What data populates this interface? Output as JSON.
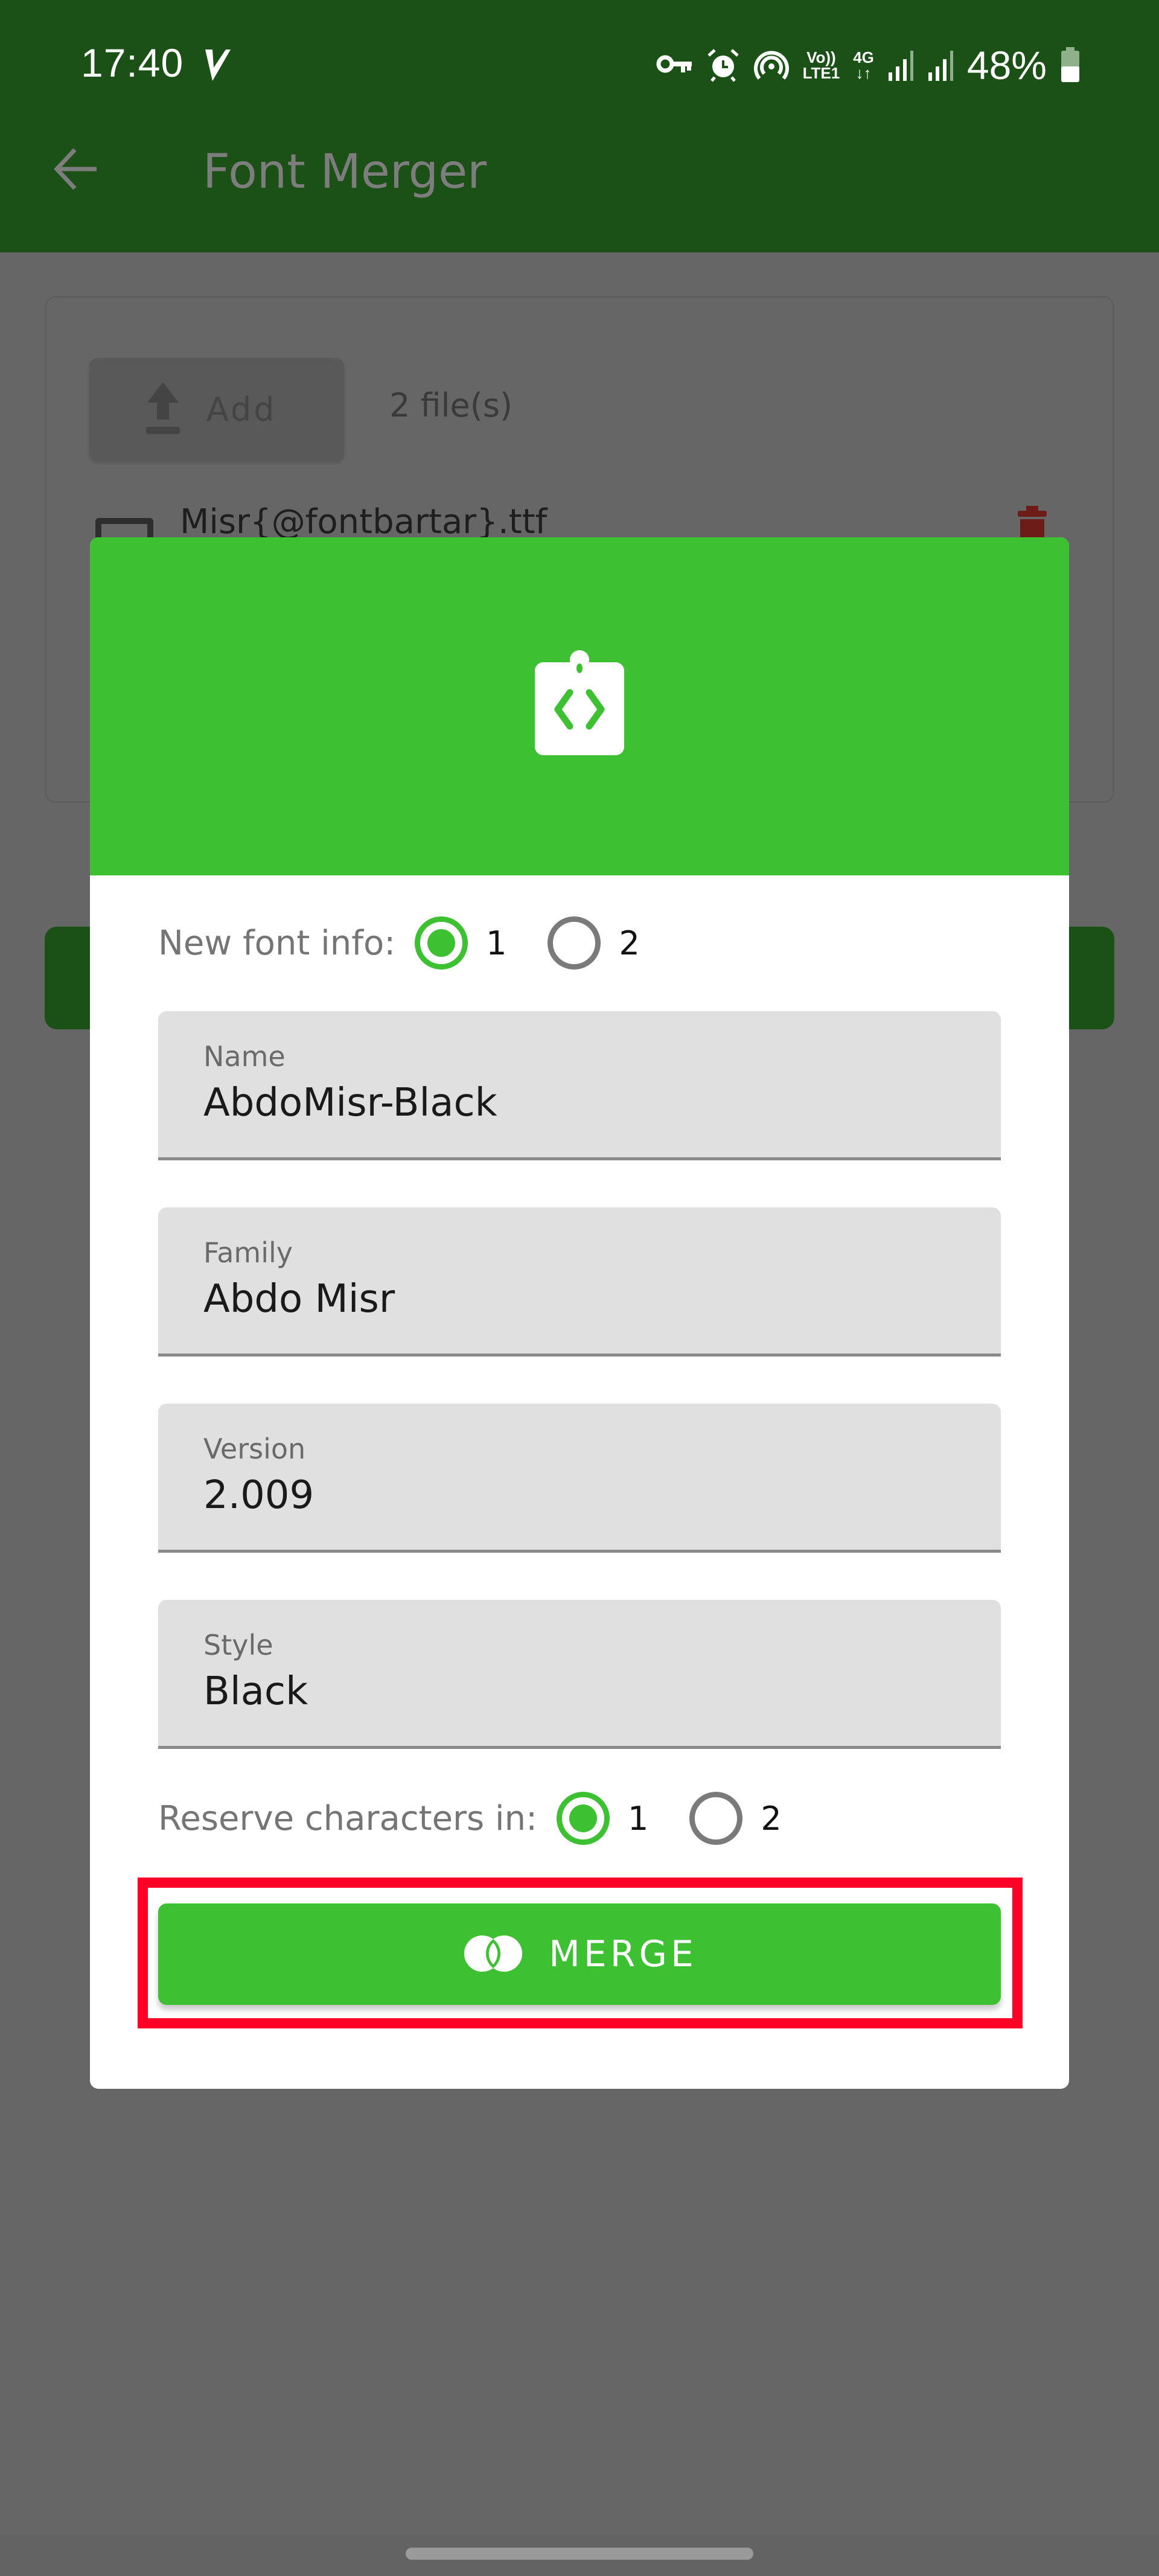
{
  "status_bar": {
    "time": "17:40",
    "icons": [
      "vpn-key-icon",
      "alarm-icon",
      "hotspot-icon",
      "volte-lte1-icon",
      "4g-data-icon",
      "signal-sim1-icon",
      "signal-sim2-icon",
      "battery-icon"
    ],
    "volte_top": "Vo))",
    "volte_bottom": "LTE1",
    "network_type": "4G",
    "network_arrows": "↓↑",
    "battery": "48%",
    "battery_level": 0.48
  },
  "app_bar": {
    "title": "Font Merger",
    "back_icon": "arrow-left-icon"
  },
  "background": {
    "add_button_label": "Add",
    "file_count": "2 file(s)",
    "files": [
      {
        "name": "Misr{@fontbartar}.ttf"
      }
    ]
  },
  "dialog": {
    "header_icon": "code-badge-icon",
    "new_font_info": {
      "label": "New font info:",
      "options": [
        "1",
        "2"
      ],
      "selected": "1"
    },
    "fields": [
      {
        "label": "Name",
        "value": "AbdoMisr-Black"
      },
      {
        "label": "Family",
        "value": "Abdo Misr"
      },
      {
        "label": "Version",
        "value": "2.009"
      },
      {
        "label": "Style",
        "value": "Black"
      }
    ],
    "reserve_characters": {
      "label": "Reserve characters in:",
      "options": [
        "1",
        "2"
      ],
      "selected": "1"
    },
    "merge_button_label": "MERGE",
    "merge_icon": "merge-circles-icon"
  },
  "colors": {
    "primary_green": "#3ec033",
    "dimmed_app_bar": "#1b5116",
    "scrim": "#666666",
    "highlight_box": "#ff0026"
  }
}
